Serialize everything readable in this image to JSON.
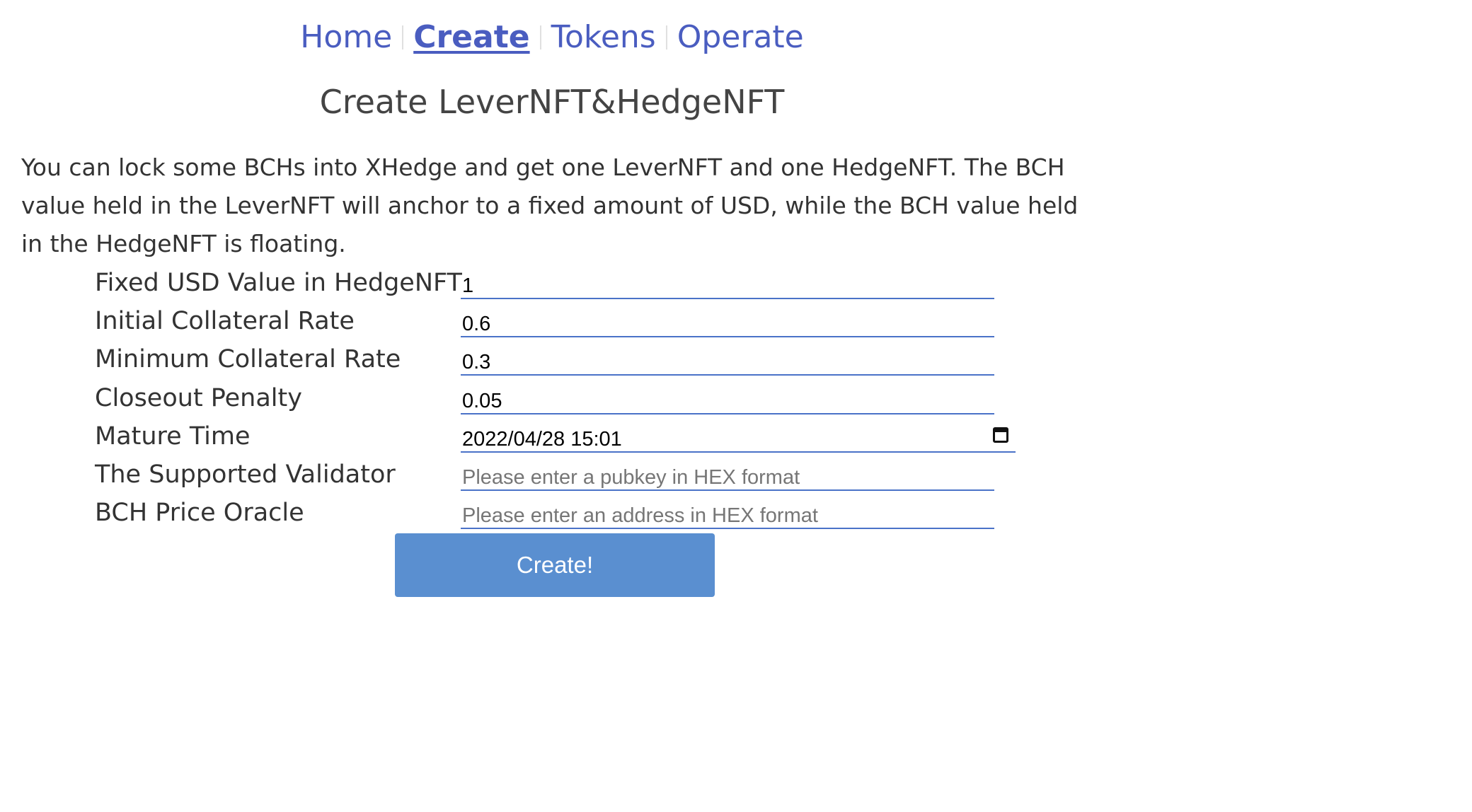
{
  "nav": {
    "items": [
      {
        "label": "Home",
        "active": false
      },
      {
        "label": "Create",
        "active": true
      },
      {
        "label": "Tokens",
        "active": false
      },
      {
        "label": "Operate",
        "active": false
      }
    ]
  },
  "page_title": "Create LeverNFT&HedgeNFT",
  "description": "You can lock some BCHs into XHedge and get one LeverNFT and one HedgeNFT. The BCH value held in the LeverNFT will anchor to a fixed amount of USD, while the BCH value held in the HedgeNFT is floating.",
  "form": {
    "fixed_usd": {
      "label": "Fixed USD Value in HedgeNFT",
      "value": "1"
    },
    "initial_collateral_rate": {
      "label": "Initial Collateral Rate",
      "value": "0.6"
    },
    "min_collateral_rate": {
      "label": "Minimum Collateral Rate",
      "value": "0.3"
    },
    "closeout_penalty": {
      "label": "Closeout Penalty",
      "value": "0.05"
    },
    "mature_time": {
      "label": "Mature Time",
      "value": "2022/04/28 15:01",
      "icon": "calendar-icon"
    },
    "validator": {
      "label": "The Supported Validator",
      "value": "",
      "placeholder": "Please enter a pubkey in HEX format"
    },
    "price_oracle": {
      "label": "BCH Price Oracle",
      "value": "",
      "placeholder": "Please enter an address in HEX format"
    }
  },
  "submit_label": "Create!",
  "colors": {
    "link": "#4a5dc0",
    "input_underline": "#4a72c8",
    "button_bg": "#5a8fd0",
    "text": "#333333"
  }
}
